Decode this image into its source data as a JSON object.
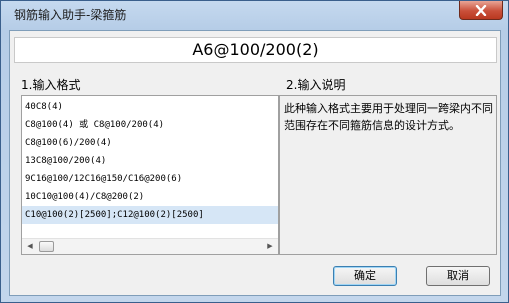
{
  "window": {
    "title": "钢筋输入助手-梁箍筋"
  },
  "input": {
    "value": "A6@100/200(2)"
  },
  "sections": {
    "format_label": "1.输入格式",
    "description_label": "2.输入说明"
  },
  "format_list": {
    "items": [
      "40C8(4)",
      "C8@100(4) 或 C8@100/200(4)",
      "C8@100(6)/200(4)",
      "13C8@100/200(4)",
      "9C16@100/12C16@150/C16@200(6)",
      "10C10@100(4)/C8@200(2)",
      "C10@100(2)[2500];C12@100(2)[2500]"
    ],
    "selected_index": 6
  },
  "description": {
    "text": "此种输入格式主要用于处理同一跨梁内不同范围存在不同箍筋信息的设计方式。"
  },
  "buttons": {
    "ok": "确定",
    "cancel": "取消"
  },
  "icons": {
    "close": "close-icon",
    "scroll_left": "arrow-left-icon",
    "scroll_right": "arrow-right-icon"
  }
}
